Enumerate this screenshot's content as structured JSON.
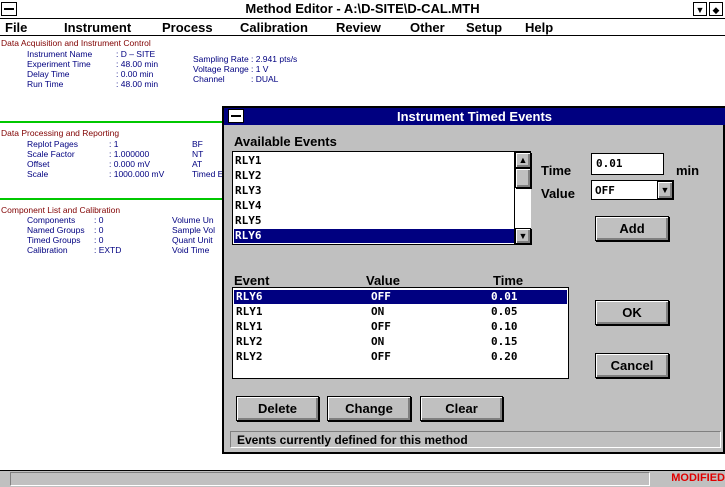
{
  "window": {
    "title": "Method Editor - A:\\D-SITE\\D-CAL.MTH"
  },
  "menu": [
    "File",
    "Instrument",
    "Process",
    "Calibration",
    "Review",
    "Other",
    "Setup",
    "Help"
  ],
  "sections": {
    "acq": {
      "title": "Data Acquisition and Instrument Control",
      "rows": [
        {
          "label": "Instrument Name",
          "value": ": D – SITE"
        },
        {
          "label": "Experiment Time",
          "value": ": 48.00 min"
        },
        {
          "label": "Delay Time",
          "value": ": 0.00 min"
        },
        {
          "label": "Run Time",
          "value": ": 48.00 min"
        }
      ],
      "rows2": [
        {
          "label": "Sampling Rate",
          "value": ": 2.941 pts/s"
        },
        {
          "label": "Voltage Range",
          "value": ": 1 V"
        },
        {
          "label": "Channel",
          "value": ": DUAL"
        }
      ]
    },
    "proc": {
      "title": "Data Processing and Reporting",
      "rows": [
        {
          "label": "Replot Pages",
          "value": ": 1"
        },
        {
          "label": "Scale Factor",
          "value": ": 1.000000"
        },
        {
          "label": "Offset",
          "value": ": 0.000 mV"
        },
        {
          "label": "Scale",
          "value": ": 1000.000 mV"
        }
      ],
      "col2": [
        "BF",
        "NT",
        "AT",
        "Timed E"
      ]
    },
    "comp": {
      "title": "Component List and Calibration",
      "rows": [
        {
          "label": "Components",
          "value": ": 0"
        },
        {
          "label": "Named Groups",
          "value": ": 0"
        },
        {
          "label": "Timed Groups",
          "value": ": 0"
        },
        {
          "label": "Calibration",
          "value": ": EXTD"
        }
      ],
      "col2": [
        "Volume Un",
        "Sample Vol",
        "Quant Unit",
        "Void Time"
      ]
    }
  },
  "dialog": {
    "title": "Instrument Timed Events",
    "available_label": "Available Events",
    "available": [
      "RLY1",
      "RLY2",
      "RLY3",
      "RLY4",
      "RLY5",
      "RLY6"
    ],
    "time_label": "Time",
    "time_value": "0.01",
    "time_unit": "min",
    "value_label": "Value",
    "value_value": "OFF",
    "add": "Add",
    "col_event": "Event",
    "col_value": "Value",
    "col_time": "Time",
    "events": [
      {
        "event": "RLY6",
        "value": "OFF",
        "time": "0.01"
      },
      {
        "event": "RLY1",
        "value": "ON",
        "time": "0.05"
      },
      {
        "event": "RLY1",
        "value": "OFF",
        "time": "0.10"
      },
      {
        "event": "RLY2",
        "value": "ON",
        "time": "0.15"
      },
      {
        "event": "RLY2",
        "value": "OFF",
        "time": "0.20"
      }
    ],
    "ok": "OK",
    "cancel": "Cancel",
    "delete": "Delete",
    "change": "Change",
    "clear": "Clear",
    "status": "Events currently defined for this method"
  },
  "statusbar": {
    "modified": "MODIFIED"
  }
}
